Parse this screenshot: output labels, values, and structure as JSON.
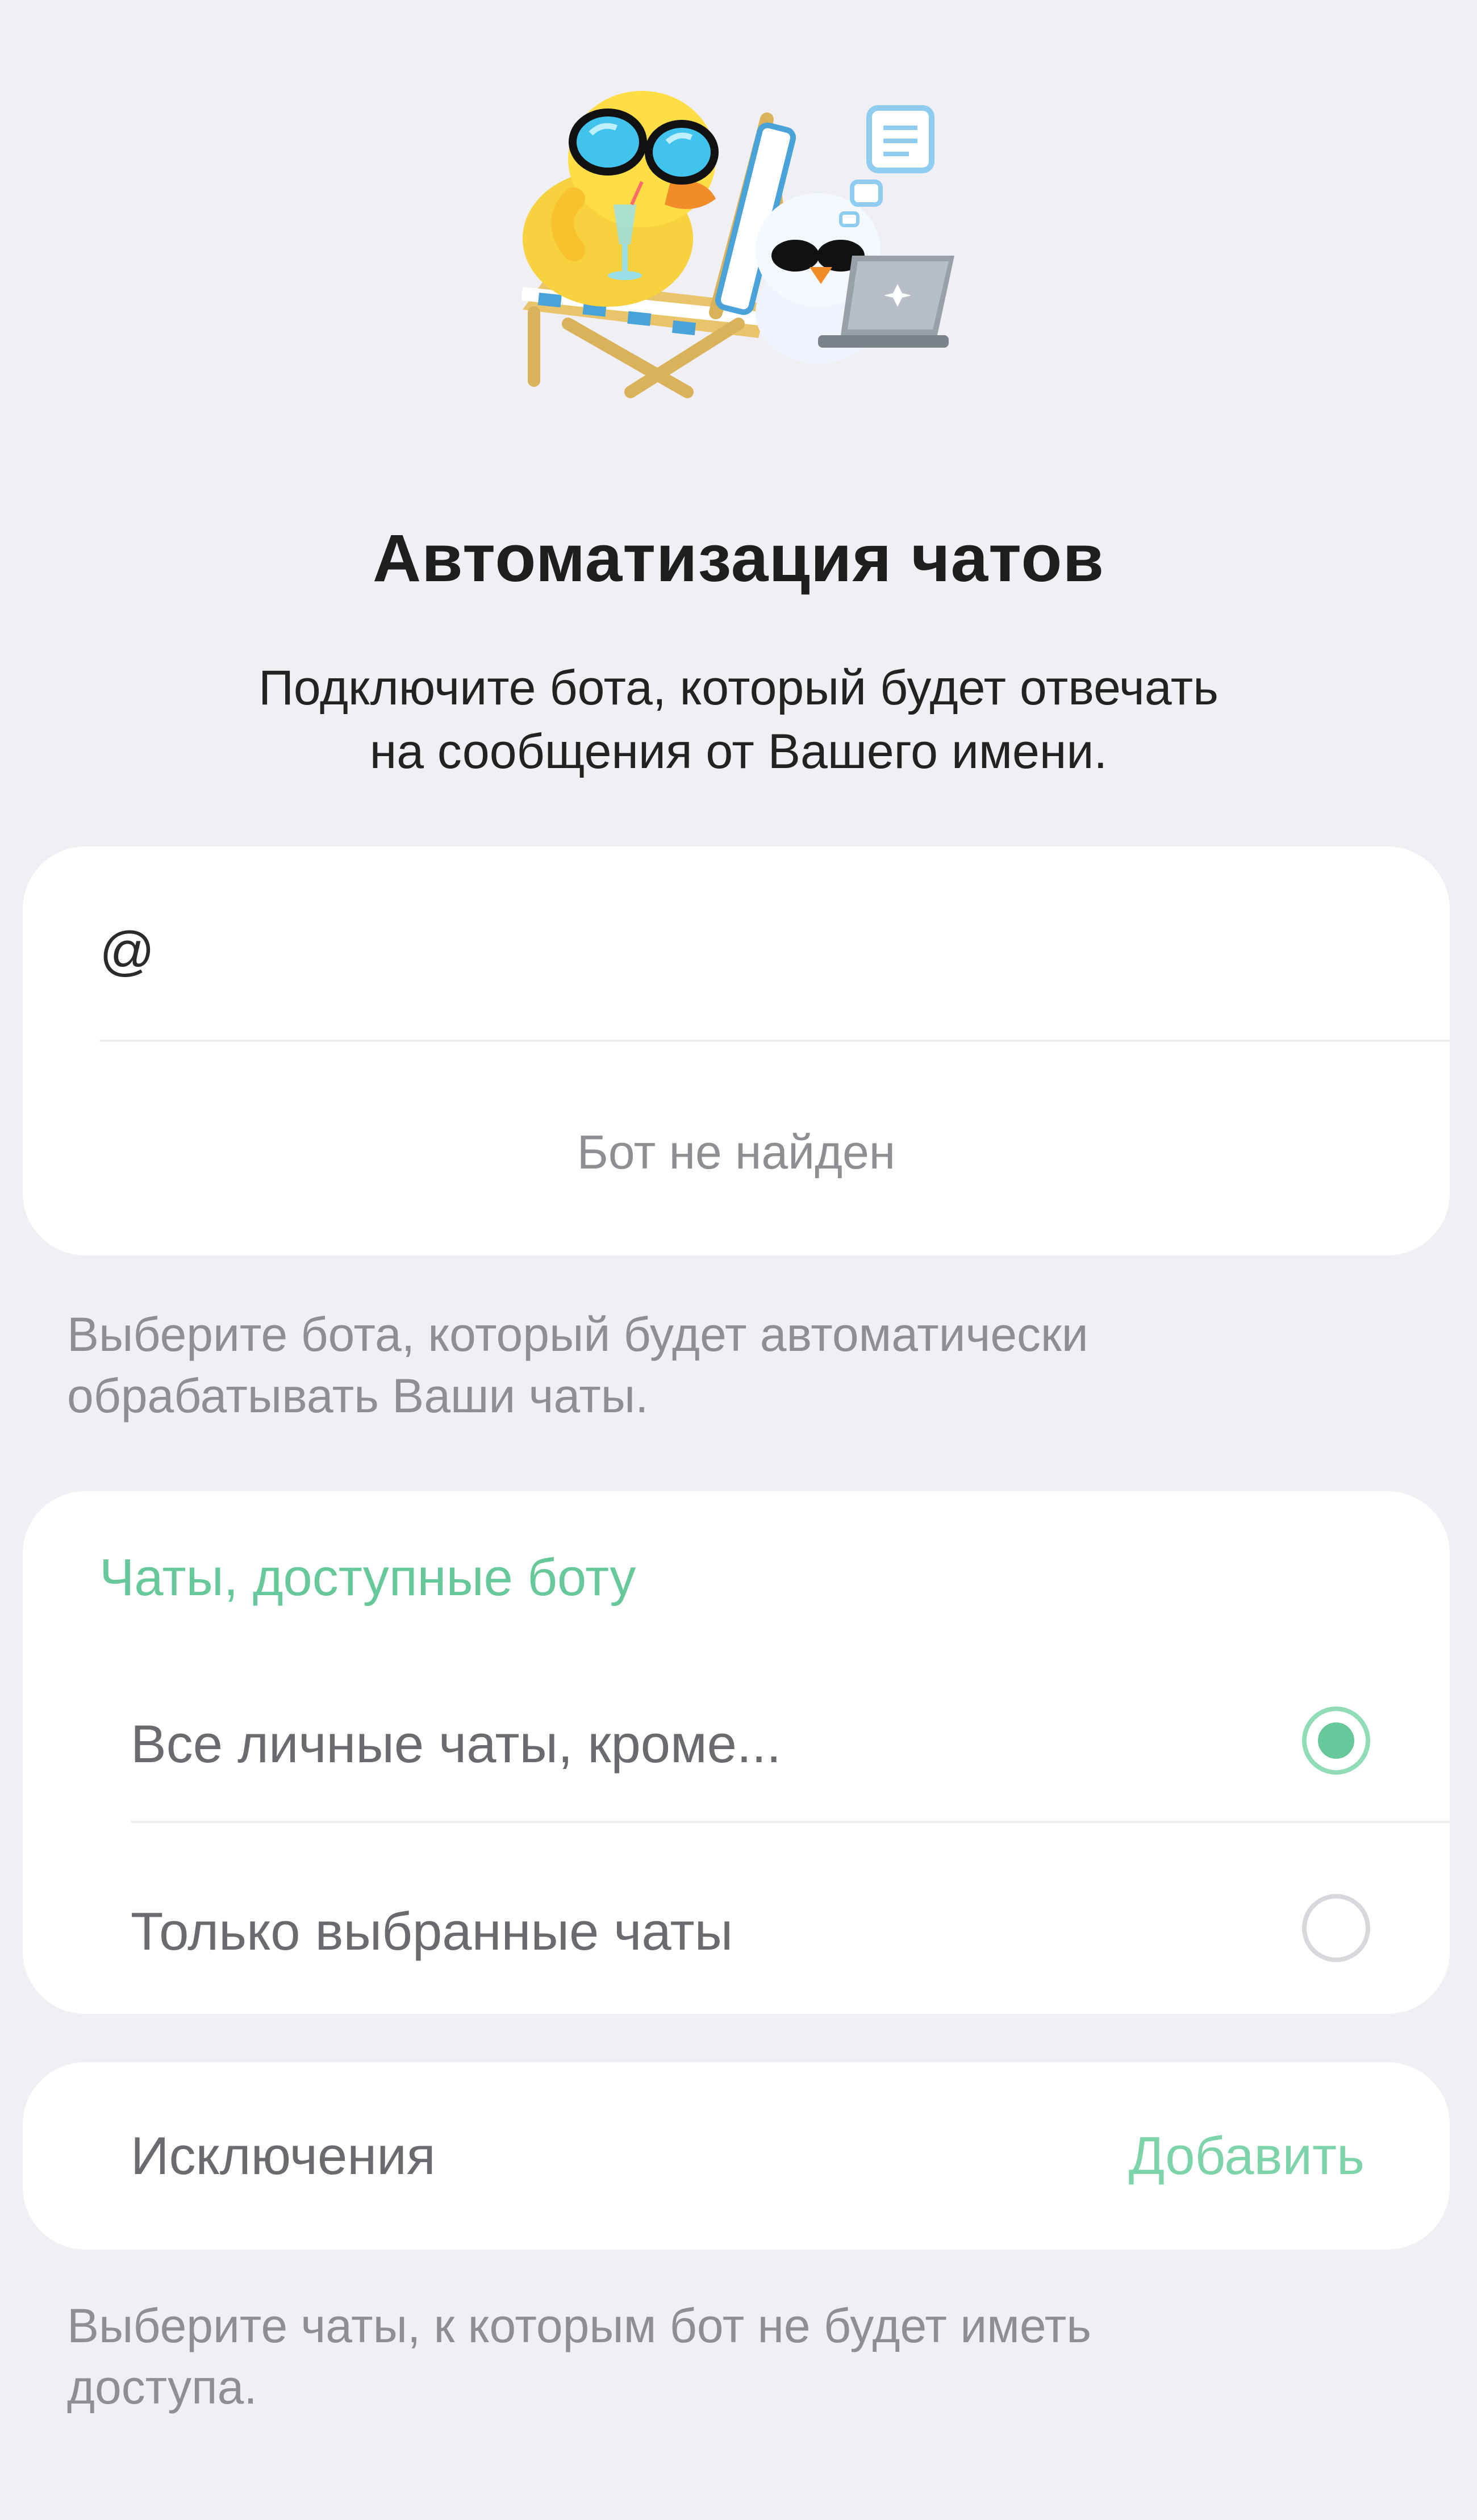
{
  "header": {
    "title": "Автоматизация чатов",
    "subtitle_line1": "Подключите бота, который будет отвечать",
    "subtitle_line2": "на сообщения от Вашего имени.",
    "illustration": "duck-on-deckchair-with-bot-sticker"
  },
  "bot_search": {
    "prefix": "@",
    "value": "",
    "status": "Бот не найден",
    "hint_line1": "Выберите бота, который будет автоматически",
    "hint_line2": "обрабатывать Ваши чаты."
  },
  "chat_access": {
    "header": "Чаты, доступные боту",
    "options": [
      {
        "label": "Все личные чаты, кроме...",
        "selected": true
      },
      {
        "label": "Только выбранные чаты",
        "selected": false
      }
    ]
  },
  "exceptions": {
    "label": "Исключения",
    "add_label": "Добавить",
    "hint_line1": "Выберите чаты, к которым бот не будет иметь",
    "hint_line2": "доступа."
  },
  "colors": {
    "background": "#efeff4",
    "card": "#ffffff",
    "accent": "#67c89b",
    "muted_text": "#8e8e93"
  }
}
